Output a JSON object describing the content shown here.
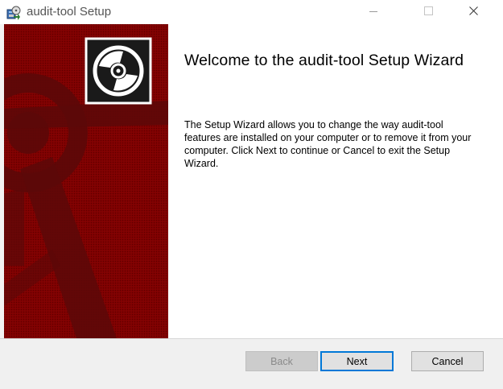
{
  "window": {
    "title": "audit-tool Setup",
    "icon": "installer-package-icon"
  },
  "title_controls": {
    "minimize_icon": "minimize-icon",
    "maximize_icon": "maximize-icon",
    "close_icon": "close-icon"
  },
  "banner": {
    "logo_icon": "cd-disc-icon",
    "background_color": "#7a0000"
  },
  "content": {
    "heading": "Welcome to the audit-tool Setup Wizard",
    "description": "The Setup Wizard allows you to change the way audit-tool features are installed on your computer or to remove it from your computer. Click Next to continue or Cancel to exit the Setup Wizard."
  },
  "buttons": {
    "back": "Back",
    "next": "Next",
    "cancel": "Cancel"
  },
  "colors": {
    "accent": "#0078d7",
    "banner_red": "#7a0000"
  }
}
